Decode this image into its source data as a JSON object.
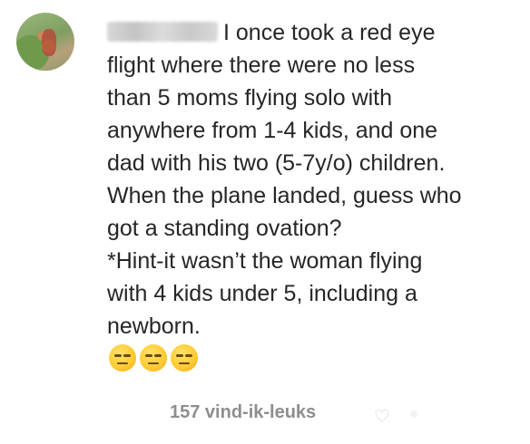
{
  "comment": {
    "lines": [
      "I once took a red eye",
      "flight where there were no less",
      "than 5 moms flying solo with",
      "anywhere from 1-4 kids, and one",
      "dad with his two (5-7y/o) children.",
      "When the plane landed, guess who",
      "got a standing ovation?",
      "*Hint-it wasn’t the woman flying",
      "with 4 kids under 5, including a",
      "newborn."
    ],
    "emojis": [
      "😑",
      "😑",
      "😑"
    ],
    "likes_label": "157 vind-ik-leuks"
  },
  "colors": {
    "text": "#262626",
    "secondary_text": "#8e8e8e",
    "background": "#ffffff"
  },
  "icons": {
    "avatar": "profile-avatar",
    "emoji": "expressionless-face-emoji"
  }
}
